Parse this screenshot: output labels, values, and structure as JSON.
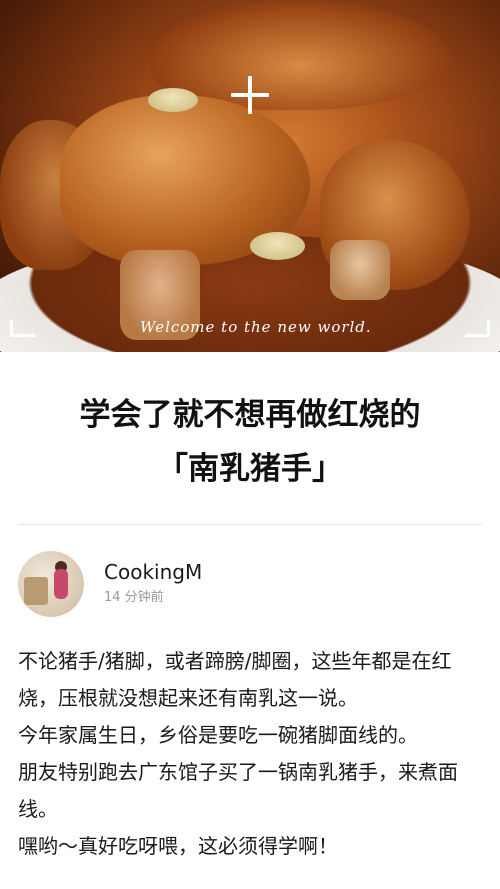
{
  "hero": {
    "image_alt": "红烧南乳猪手",
    "tagline": "Welcome to the new world."
  },
  "article": {
    "title_line1": "学会了就不想再做红烧的",
    "title_line2": "「南乳猪手」"
  },
  "author": {
    "name": "CookingM",
    "time": "14 分钟前"
  },
  "body": [
    "不论猪手/猪脚，或者蹄膀/脚圈，这些年都是在红烧，压根就没想起来还有南乳这一说。",
    "今年家属生日，乡俗是要吃一碗猪脚面线的。",
    "朋友特别跑去广东馆子买了一锅南乳猪手，来煮面线。",
    "嘿哟～真好吃呀喂，这必须得学啊！"
  ]
}
